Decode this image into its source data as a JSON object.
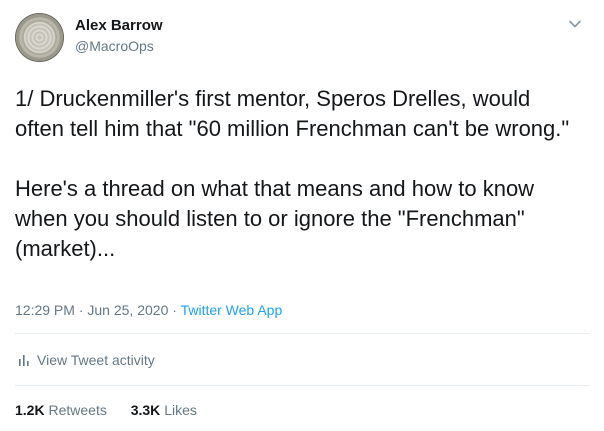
{
  "user": {
    "name": "Alex Barrow",
    "handle": "@MacroOps"
  },
  "tweet": {
    "paragraph_1": "1/ Druckenmiller's first mentor, Speros Drelles, would often tell him that \"60 million Frenchman can't be wrong.\"",
    "paragraph_2": "Here's a thread on what that means and how to know when you should listen to or ignore the \"Frenchman\" (market)...",
    "time": "12:29 PM",
    "date": "Jun 25, 2020",
    "separator": " · ",
    "app": "Twitter Web App"
  },
  "activity": {
    "label": "View Tweet activity",
    "icon": "bar-chart-icon"
  },
  "stats": {
    "retweets_count": "1.2K",
    "retweets_label": "Retweets",
    "likes_count": "3.3K",
    "likes_label": "Likes"
  },
  "menu": {
    "icon": "chevron-down-icon"
  },
  "colors": {
    "text": "#14171a",
    "secondary": "#657786",
    "link": "#1da1f2",
    "divider": "#e6ecf0"
  }
}
